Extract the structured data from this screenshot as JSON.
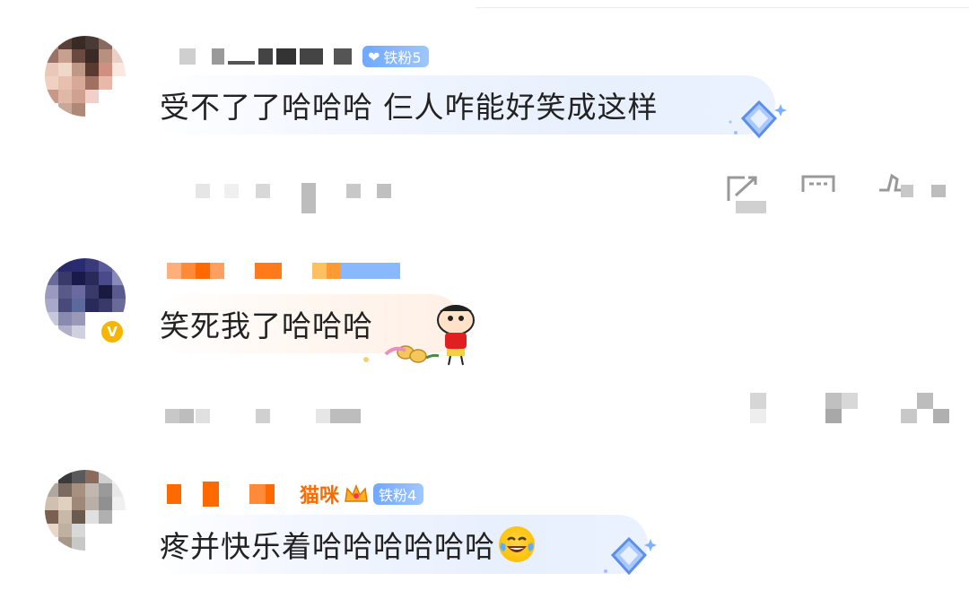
{
  "comments": [
    {
      "text": "受不了了哈哈哈 仨人咋能好笑成这样",
      "fan_badge": "铁粉5",
      "actions": [
        "share-icon",
        "comment-icon",
        "like-icon"
      ]
    },
    {
      "text": "笑死我了哈哈哈",
      "verified": "V",
      "actions": [
        "share-icon",
        "comment-icon",
        "like-icon"
      ]
    },
    {
      "text": "疼并快乐着哈哈哈哈哈哈",
      "username_partial": "猫咪",
      "fan_badge": "铁粉4",
      "emoji": "laughing-tears-emoji"
    }
  ],
  "colors": {
    "badge_blue": "#7fb4ff",
    "verified_gold": "#f7b500",
    "bubble_blue": "#e8f0fd",
    "username_orange": "#ff7a1a"
  }
}
